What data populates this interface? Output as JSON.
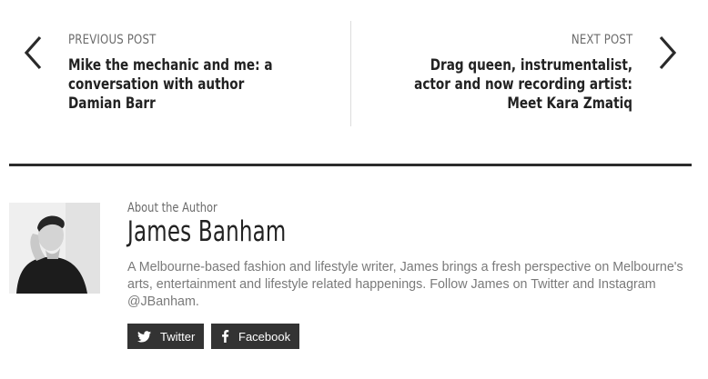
{
  "post_nav": {
    "previous": {
      "kicker": "PREVIOUS POST",
      "title": "Mike the mechanic and me: a conversation with author Damian Barr"
    },
    "next": {
      "kicker": "NEXT POST",
      "title": "Drag queen, instrumentalist, actor and now recording artist: Meet Kara Zmatiq"
    }
  },
  "author": {
    "kicker": "About the Author",
    "name": "James Banham",
    "bio": "A Melbourne-based fashion and lifestyle writer, James brings a fresh perspective on Melbourne's arts, entertainment and lifestyle related happenings. Follow James on Twitter and Instagram @JBanham.",
    "social": {
      "twitter_label": "Twitter",
      "facebook_label": "Facebook"
    }
  },
  "icons": {
    "prev": "chevron-left-icon",
    "next": "chevron-right-icon",
    "twitter": "twitter-icon",
    "facebook": "facebook-icon"
  },
  "colors": {
    "text": "#222222",
    "muted": "#6b6b6b",
    "button_bg": "#333333",
    "rule": "#2b2b2b"
  }
}
